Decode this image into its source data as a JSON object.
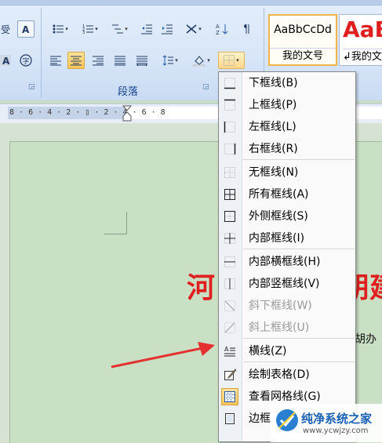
{
  "ribbon": {
    "group_label": "段落",
    "styles": [
      {
        "sample": "AaBbCcDd",
        "name": "我的文号"
      },
      {
        "sample": "AaB",
        "name": "↲我的文"
      }
    ]
  },
  "ruler": {
    "ticks": "8 · 6 · 4 · 2 · ▯ · 2 · 4 · 6 · 8"
  },
  "document": {
    "title_left": "河",
    "title_right": "朋建",
    "text_fragment": "胡办"
  },
  "border_menu": {
    "items": [
      {
        "label": "下框线(B)",
        "icon": "bottom-border-icon",
        "enabled": true
      },
      {
        "label": "上框线(P)",
        "icon": "top-border-icon",
        "enabled": true
      },
      {
        "label": "左框线(L)",
        "icon": "left-border-icon",
        "enabled": true
      },
      {
        "label": "右框线(R)",
        "icon": "right-border-icon",
        "enabled": true
      },
      {
        "label": "无框线(N)",
        "icon": "no-border-icon",
        "enabled": true
      },
      {
        "label": "所有框线(A)",
        "icon": "all-borders-icon",
        "enabled": true
      },
      {
        "label": "外侧框线(S)",
        "icon": "outside-borders-icon",
        "enabled": true
      },
      {
        "label": "内部框线(I)",
        "icon": "inside-borders-icon",
        "enabled": true
      },
      {
        "label": "内部横框线(H)",
        "icon": "inside-horizontal-border-icon",
        "enabled": true
      },
      {
        "label": "内部竖框线(V)",
        "icon": "inside-vertical-border-icon",
        "enabled": true
      },
      {
        "label": "斜下框线(W)",
        "icon": "diagonal-down-border-icon",
        "enabled": false
      },
      {
        "label": "斜上框线(U)",
        "icon": "diagonal-up-border-icon",
        "enabled": false
      },
      {
        "label": "横线(Z)",
        "icon": "horizontal-line-icon",
        "enabled": true
      },
      {
        "label": "绘制表格(D)",
        "icon": "draw-table-icon",
        "enabled": true
      },
      {
        "label": "查看网格线(G)",
        "icon": "view-gridlines-icon",
        "enabled": true
      },
      {
        "label": "边框",
        "icon": "borders-and-shading-icon",
        "enabled": true
      }
    ]
  },
  "watermark": {
    "title": "纯净系统之家",
    "url": "www.ycwjzy.com"
  },
  "colors": {
    "annotation_arrow": "#e53030",
    "title_red": "#e02020",
    "menu_highlight": "#ffc65a"
  }
}
